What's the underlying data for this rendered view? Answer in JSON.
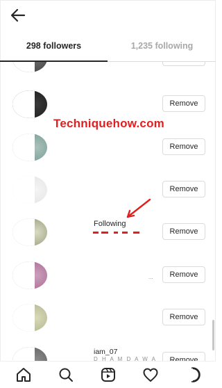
{
  "header": {
    "back_icon": "arrow-left-icon"
  },
  "tabs": [
    {
      "label": "298 followers",
      "active": true
    },
    {
      "label": "1,235 following",
      "active": false
    }
  ],
  "list": {
    "remove_label": "Remove",
    "rows": [
      {
        "avatar_colors": [
          "#2e2e2e",
          "#6b6b6b"
        ]
      },
      {
        "avatar_colors": [
          "#0d0d0d",
          "#3a3a3a"
        ]
      },
      {
        "avatar_colors": [
          "#5d8a84",
          "#aac1ba"
        ]
      },
      {
        "avatar_colors": [
          "#dcdcdc",
          "#f4f4f4"
        ]
      },
      {
        "avatar_colors": [
          "#7a7a5e",
          "#d8dcc0"
        ]
      },
      {
        "avatar_colors": [
          "#9c4d7c",
          "#caa0bc"
        ]
      },
      {
        "avatar_colors": [
          "#9ea17a",
          "#d8dab8"
        ]
      },
      {
        "avatar_colors": [
          "#4b4b4b",
          "#8b8b8b"
        ]
      }
    ]
  },
  "annotations": {
    "watermark": "Techniquehow.com",
    "following_label": "Following",
    "username_fragment": "iam_07",
    "subtext_fragment": "D H A M D A W A",
    "dots": "..."
  },
  "colors": {
    "accent_red": "#e02020",
    "text": "#262626",
    "muted": "#a8a8a8",
    "border": "#dbdbdb"
  },
  "bottom_nav": [
    {
      "icon": "home-icon"
    },
    {
      "icon": "search-icon"
    },
    {
      "icon": "reels-icon"
    },
    {
      "icon": "heart-icon"
    },
    {
      "icon": "profile-icon"
    }
  ]
}
